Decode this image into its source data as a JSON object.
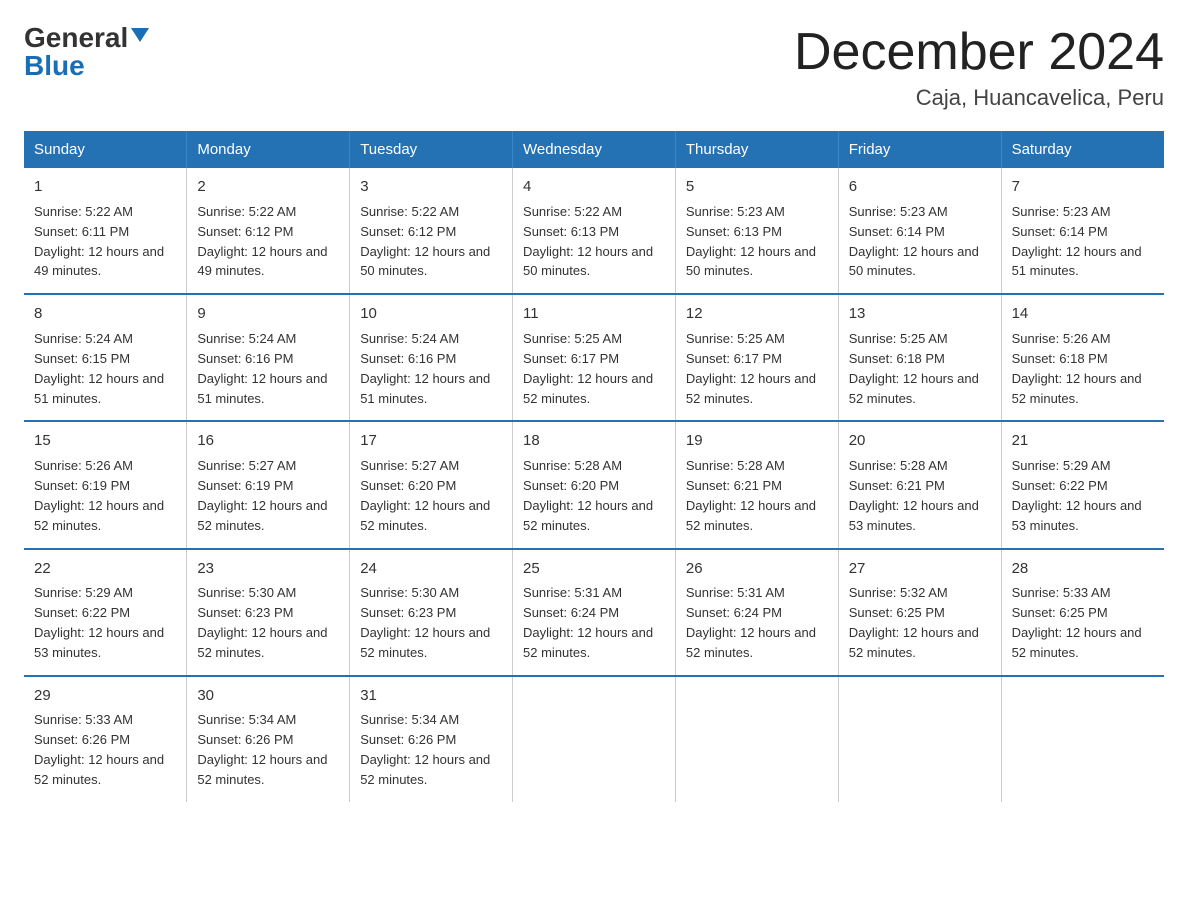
{
  "logo": {
    "general": "General",
    "blue": "Blue"
  },
  "title": "December 2024",
  "subtitle": "Caja, Huancavelica, Peru",
  "days": [
    "Sunday",
    "Monday",
    "Tuesday",
    "Wednesday",
    "Thursday",
    "Friday",
    "Saturday"
  ],
  "weeks": [
    [
      {
        "num": "1",
        "sunrise": "5:22 AM",
        "sunset": "6:11 PM",
        "daylight": "12 hours and 49 minutes."
      },
      {
        "num": "2",
        "sunrise": "5:22 AM",
        "sunset": "6:12 PM",
        "daylight": "12 hours and 49 minutes."
      },
      {
        "num": "3",
        "sunrise": "5:22 AM",
        "sunset": "6:12 PM",
        "daylight": "12 hours and 50 minutes."
      },
      {
        "num": "4",
        "sunrise": "5:22 AM",
        "sunset": "6:13 PM",
        "daylight": "12 hours and 50 minutes."
      },
      {
        "num": "5",
        "sunrise": "5:23 AM",
        "sunset": "6:13 PM",
        "daylight": "12 hours and 50 minutes."
      },
      {
        "num": "6",
        "sunrise": "5:23 AM",
        "sunset": "6:14 PM",
        "daylight": "12 hours and 50 minutes."
      },
      {
        "num": "7",
        "sunrise": "5:23 AM",
        "sunset": "6:14 PM",
        "daylight": "12 hours and 51 minutes."
      }
    ],
    [
      {
        "num": "8",
        "sunrise": "5:24 AM",
        "sunset": "6:15 PM",
        "daylight": "12 hours and 51 minutes."
      },
      {
        "num": "9",
        "sunrise": "5:24 AM",
        "sunset": "6:16 PM",
        "daylight": "12 hours and 51 minutes."
      },
      {
        "num": "10",
        "sunrise": "5:24 AM",
        "sunset": "6:16 PM",
        "daylight": "12 hours and 51 minutes."
      },
      {
        "num": "11",
        "sunrise": "5:25 AM",
        "sunset": "6:17 PM",
        "daylight": "12 hours and 52 minutes."
      },
      {
        "num": "12",
        "sunrise": "5:25 AM",
        "sunset": "6:17 PM",
        "daylight": "12 hours and 52 minutes."
      },
      {
        "num": "13",
        "sunrise": "5:25 AM",
        "sunset": "6:18 PM",
        "daylight": "12 hours and 52 minutes."
      },
      {
        "num": "14",
        "sunrise": "5:26 AM",
        "sunset": "6:18 PM",
        "daylight": "12 hours and 52 minutes."
      }
    ],
    [
      {
        "num": "15",
        "sunrise": "5:26 AM",
        "sunset": "6:19 PM",
        "daylight": "12 hours and 52 minutes."
      },
      {
        "num": "16",
        "sunrise": "5:27 AM",
        "sunset": "6:19 PM",
        "daylight": "12 hours and 52 minutes."
      },
      {
        "num": "17",
        "sunrise": "5:27 AM",
        "sunset": "6:20 PM",
        "daylight": "12 hours and 52 minutes."
      },
      {
        "num": "18",
        "sunrise": "5:28 AM",
        "sunset": "6:20 PM",
        "daylight": "12 hours and 52 minutes."
      },
      {
        "num": "19",
        "sunrise": "5:28 AM",
        "sunset": "6:21 PM",
        "daylight": "12 hours and 52 minutes."
      },
      {
        "num": "20",
        "sunrise": "5:28 AM",
        "sunset": "6:21 PM",
        "daylight": "12 hours and 53 minutes."
      },
      {
        "num": "21",
        "sunrise": "5:29 AM",
        "sunset": "6:22 PM",
        "daylight": "12 hours and 53 minutes."
      }
    ],
    [
      {
        "num": "22",
        "sunrise": "5:29 AM",
        "sunset": "6:22 PM",
        "daylight": "12 hours and 53 minutes."
      },
      {
        "num": "23",
        "sunrise": "5:30 AM",
        "sunset": "6:23 PM",
        "daylight": "12 hours and 52 minutes."
      },
      {
        "num": "24",
        "sunrise": "5:30 AM",
        "sunset": "6:23 PM",
        "daylight": "12 hours and 52 minutes."
      },
      {
        "num": "25",
        "sunrise": "5:31 AM",
        "sunset": "6:24 PM",
        "daylight": "12 hours and 52 minutes."
      },
      {
        "num": "26",
        "sunrise": "5:31 AM",
        "sunset": "6:24 PM",
        "daylight": "12 hours and 52 minutes."
      },
      {
        "num": "27",
        "sunrise": "5:32 AM",
        "sunset": "6:25 PM",
        "daylight": "12 hours and 52 minutes."
      },
      {
        "num": "28",
        "sunrise": "5:33 AM",
        "sunset": "6:25 PM",
        "daylight": "12 hours and 52 minutes."
      }
    ],
    [
      {
        "num": "29",
        "sunrise": "5:33 AM",
        "sunset": "6:26 PM",
        "daylight": "12 hours and 52 minutes."
      },
      {
        "num": "30",
        "sunrise": "5:34 AM",
        "sunset": "6:26 PM",
        "daylight": "12 hours and 52 minutes."
      },
      {
        "num": "31",
        "sunrise": "5:34 AM",
        "sunset": "6:26 PM",
        "daylight": "12 hours and 52 minutes."
      },
      null,
      null,
      null,
      null
    ]
  ]
}
